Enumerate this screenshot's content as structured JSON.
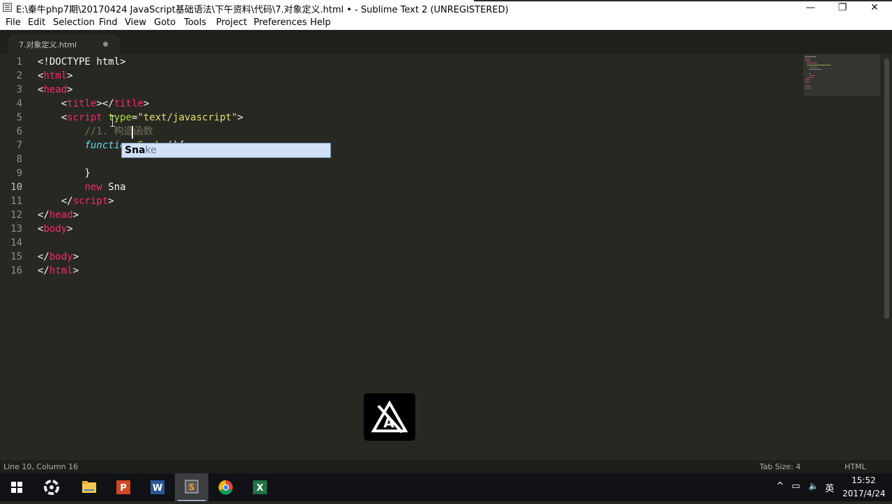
{
  "window": {
    "title": "E:\\秦牛php7期\\20170424 JavaScript基础语法\\下午资料\\代码\\7.对象定义.html • - Sublime Text 2 (UNREGISTERED)",
    "controls": {
      "minimize": "—",
      "maximize": "❐",
      "close": "✕"
    }
  },
  "menu": {
    "items": [
      "File",
      "Edit",
      "Selection",
      "Find",
      "View",
      "Goto",
      "Tools",
      "Project",
      "Preferences",
      "Help"
    ]
  },
  "tab": {
    "label": "7.对象定义.html",
    "dirty": true
  },
  "editor": {
    "active_line": 10,
    "line_numbers": [
      "1",
      "2",
      "3",
      "4",
      "5",
      "6",
      "7",
      "8",
      "9",
      "10",
      "11",
      "12",
      "13",
      "14",
      "15",
      "16"
    ]
  },
  "code_lines": [
    [
      [
        "plain",
        "<!DOCTYPE html>"
      ]
    ],
    [
      [
        "plain",
        "<"
      ],
      [
        "tag",
        "html"
      ],
      [
        "plain",
        ">"
      ]
    ],
    [
      [
        "plain",
        "<"
      ],
      [
        "tag",
        "head"
      ],
      [
        "plain",
        ">"
      ]
    ],
    [
      [
        "plain",
        "    <"
      ],
      [
        "tag",
        "title"
      ],
      [
        "plain",
        "></"
      ],
      [
        "tag",
        "title"
      ],
      [
        "plain",
        ">"
      ]
    ],
    [
      [
        "plain",
        "    <"
      ],
      [
        "tag",
        "script"
      ],
      [
        "plain",
        " "
      ],
      [
        "attr",
        "type"
      ],
      [
        "plain",
        "="
      ],
      [
        "str",
        "\"text/javascript\""
      ],
      [
        "plain",
        ">"
      ]
    ],
    [
      [
        "plain",
        "        "
      ],
      [
        "cmt",
        "//1. 构造函数"
      ]
    ],
    [
      [
        "plain",
        "        "
      ],
      [
        "kw",
        "function"
      ],
      [
        "plain",
        " "
      ],
      [
        "fn",
        "Snake"
      ],
      [
        "plain",
        "(){"
      ]
    ],
    [
      [
        "plain",
        ""
      ]
    ],
    [
      [
        "plain",
        "        }"
      ]
    ],
    [
      [
        "plain",
        "        "
      ],
      [
        "tag",
        "new"
      ],
      [
        "plain",
        " Sna"
      ]
    ],
    [
      [
        "plain",
        "    </"
      ],
      [
        "tag",
        "script"
      ],
      [
        "plain",
        ">"
      ]
    ],
    [
      [
        "plain",
        "</"
      ],
      [
        "tag",
        "head"
      ],
      [
        "plain",
        ">"
      ]
    ],
    [
      [
        "plain",
        "<"
      ],
      [
        "tag",
        "body"
      ],
      [
        "plain",
        ">"
      ]
    ],
    [
      [
        "plain",
        ""
      ]
    ],
    [
      [
        "plain",
        "</"
      ],
      [
        "tag",
        "body"
      ],
      [
        "plain",
        ">"
      ]
    ],
    [
      [
        "plain",
        "</"
      ],
      [
        "tag",
        "html"
      ],
      [
        "plain",
        ">"
      ]
    ]
  ],
  "autocomplete": {
    "matched": "Sna",
    "rest": "ke"
  },
  "status": {
    "position": "Line 10, Column 16",
    "tab_size": "Tab Size: 4",
    "syntax": "HTML"
  },
  "taskbar": {
    "apps": [
      "windows-start",
      "app-swirl",
      "file-explorer",
      "powerpoint",
      "word",
      "sublime-text",
      "chrome",
      "excel"
    ],
    "tray": {
      "chevron": "^",
      "network": "▭",
      "volume": "🔈",
      "ime": "英"
    },
    "time": "15:52",
    "date": "2017/4/24"
  },
  "colors": {
    "editor_bg": "#272822",
    "tag": "#f92672",
    "string": "#e6db74",
    "comment": "#75715e",
    "keyword": "#66d9ef",
    "function": "#a6e22e",
    "autocomplete_bg": "#cfe0f6"
  }
}
